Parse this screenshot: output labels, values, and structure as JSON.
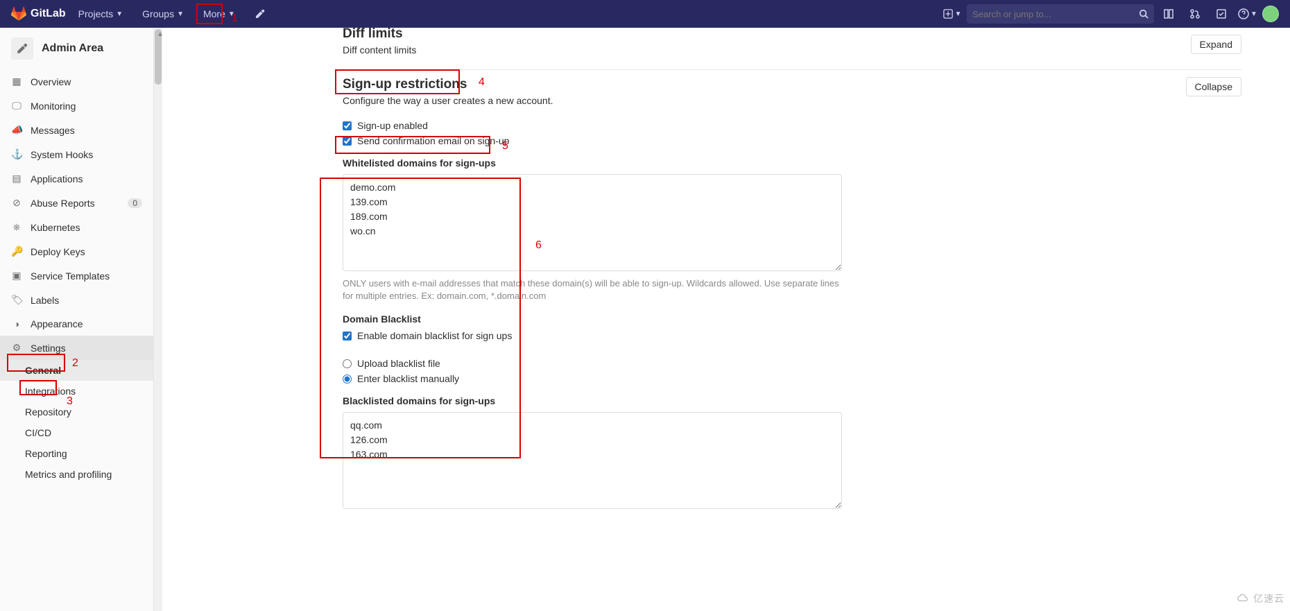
{
  "navbar": {
    "brand": "GitLab",
    "items": [
      "Projects",
      "Groups",
      "More"
    ],
    "search_placeholder": "Search or jump to..."
  },
  "sidebar": {
    "title": "Admin Area",
    "items": [
      {
        "icon": "grid",
        "label": "Overview"
      },
      {
        "icon": "monitor",
        "label": "Monitoring"
      },
      {
        "icon": "megaphone",
        "label": "Messages"
      },
      {
        "icon": "anchor",
        "label": "System Hooks"
      },
      {
        "icon": "apps",
        "label": "Applications"
      },
      {
        "icon": "exclaim",
        "label": "Abuse Reports",
        "badge": "0"
      },
      {
        "icon": "kube",
        "label": "Kubernetes"
      },
      {
        "icon": "key",
        "label": "Deploy Keys"
      },
      {
        "icon": "template",
        "label": "Service Templates"
      },
      {
        "icon": "tag",
        "label": "Labels"
      },
      {
        "icon": "appearance",
        "label": "Appearance"
      },
      {
        "icon": "gear",
        "label": "Settings",
        "active": true
      }
    ],
    "sub": [
      "General",
      "Integrations",
      "Repository",
      "CI/CD",
      "Reporting",
      "Metrics and profiling"
    ]
  },
  "sections": {
    "diff": {
      "title": "Diff limits",
      "desc": "Diff content limits",
      "button": "Expand"
    },
    "signup": {
      "title": "Sign-up restrictions",
      "desc": "Configure the way a user creates a new account.",
      "button": "Collapse",
      "signup_enabled_label": "Sign-up enabled",
      "confirm_email_label": "Send confirmation email on sign-up",
      "whitelist_label": "Whitelisted domains for sign-ups",
      "whitelist_value": "demo.com\n139.com\n189.com\nwo.cn",
      "whitelist_help": "ONLY users with e-mail addresses that match these domain(s) will be able to sign-up. Wildcards allowed. Use separate lines for multiple entries. Ex: domain.com, *.domain.com",
      "blacklist_heading": "Domain Blacklist",
      "enable_blacklist_label": "Enable domain blacklist for sign ups",
      "upload_label": "Upload blacklist file",
      "manual_label": "Enter blacklist manually",
      "blacklist_label": "Blacklisted domains for sign-ups",
      "blacklist_value": "qq.com\n126.com\n163.com"
    }
  },
  "annotations": [
    "1",
    "2",
    "3",
    "4",
    "5",
    "6"
  ],
  "watermark": "亿速云"
}
